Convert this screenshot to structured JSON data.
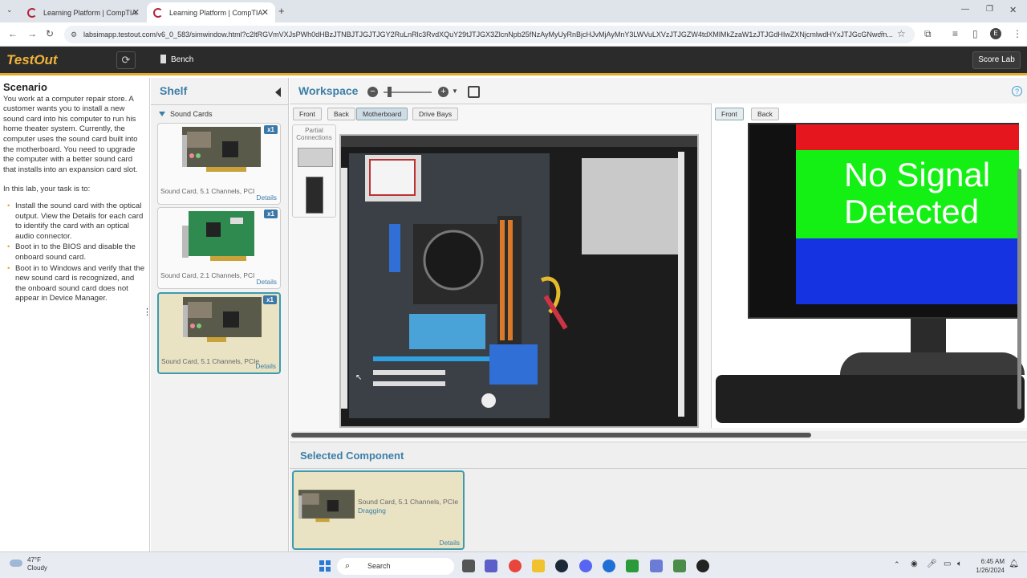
{
  "browser": {
    "tabs": [
      {
        "title": "Learning Platform | CompTIA"
      },
      {
        "title": "Learning Platform | CompTIA"
      }
    ],
    "url": "labsimapp.testout.com/v6_0_583/simwindow.html?c2ltRGVmVXJsPWh0dHBzJTNBJTJGJTJGY2RuLnRlc3RvdXQuY29tJTJGX3ZlcnNpb25fNzAyMyUyRnBjcHJvMjAyMnY3LWVuLXVzJTJGZW4tdXMlMkZzaW1zJTJGdHIwZXNjcmlwdHYxJTJGcGNwcm..."
  },
  "app": {
    "logo": "TestOut",
    "bench_label": "Bench",
    "score_label": "Score Lab"
  },
  "scenario": {
    "title": "Scenario",
    "intro": "You work at a computer repair store. A customer wants you to install a new sound card into his computer to run his home theater system. Currently, the computer uses the sound card built into the motherboard. You need to upgrade the computer with a better sound card that installs into an expansion card slot.",
    "task_intro": "In this lab, your task is to:",
    "tasks": [
      "Install the sound card with the optical output. View the Details for each card to identify the card with an optical audio connector.",
      "Boot in to the BIOS and disable the onboard sound card.",
      "Boot in to Windows and verify that the new sound card is recognized, and the onboard sound card does not appear in Device Manager."
    ]
  },
  "shelf": {
    "title": "Shelf",
    "category": "Sound Cards",
    "items": [
      {
        "label": "Sound Card, 5.1 Channels, PCI",
        "qty": "x1",
        "details": "Details"
      },
      {
        "label": "Sound Card, 2.1 Channels, PCI",
        "qty": "x1",
        "details": "Details"
      },
      {
        "label": "Sound Card, 5.1 Channels, PCIe",
        "qty": "x1",
        "details": "Details"
      }
    ]
  },
  "workspace": {
    "title": "Workspace",
    "view_buttons": [
      "Front",
      "Back",
      "Motherboard",
      "Drive Bays"
    ],
    "active_view": "Motherboard",
    "partial_connections": "Partial Connections",
    "monitor_buttons": [
      "Front",
      "Back"
    ],
    "monitor_message": [
      "No Signal",
      "Detected"
    ]
  },
  "selected": {
    "title": "Selected Component",
    "name": "Sound Card, 5.1 Channels, PCIe",
    "status": "Dragging",
    "details": "Details"
  },
  "taskbar": {
    "temperature": "47°F",
    "condition": "Cloudy",
    "search": "Search",
    "time": "6:45 AM",
    "date": "1/26/2024"
  },
  "colors": {
    "accent": "#3d7ea6",
    "brand": "#f0b43a",
    "selected_bg": "#e9e3c4"
  }
}
